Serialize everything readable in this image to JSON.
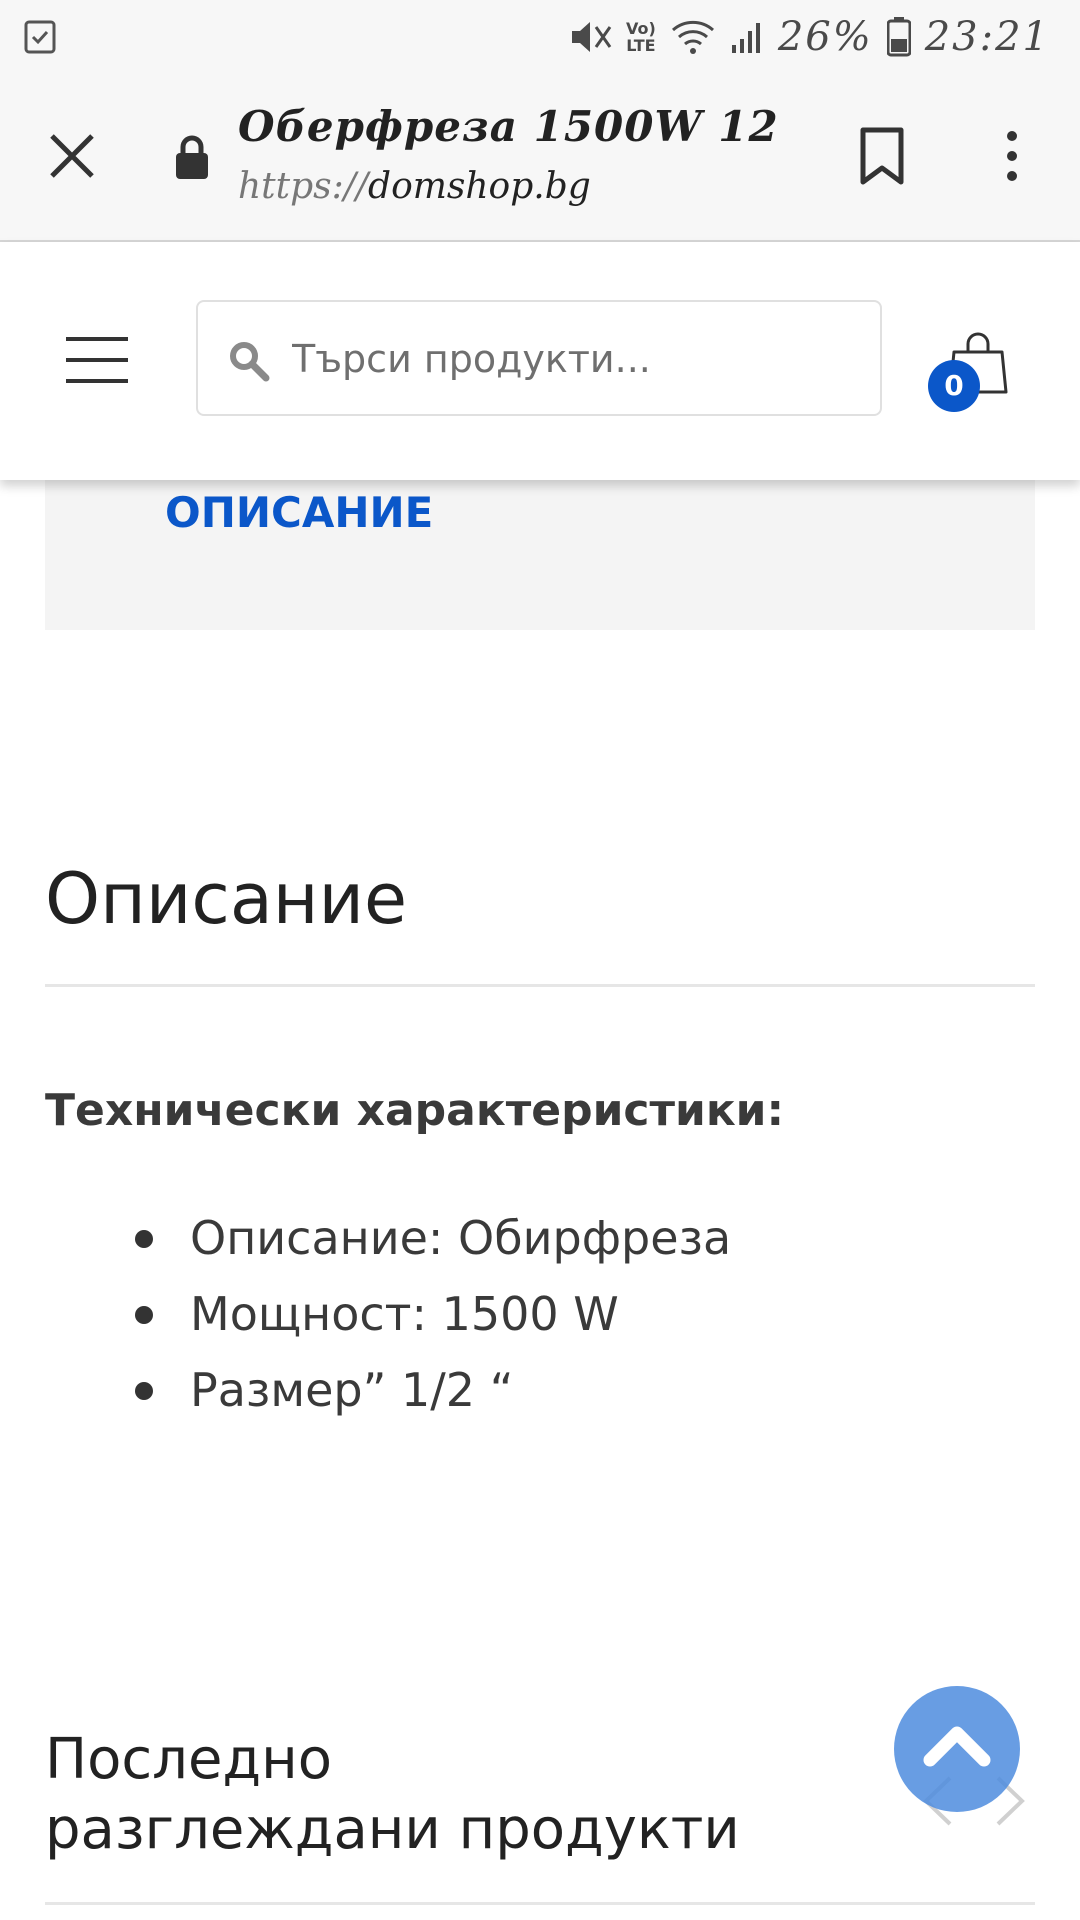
{
  "status_bar": {
    "battery": "26%",
    "time": "23:21",
    "network_top": "Vo)",
    "network_bottom": "LTE"
  },
  "browser": {
    "page_title": "Оберфреза 1500W 12\" ...",
    "url_protocol": "https://",
    "url_domain": "domshop.bg"
  },
  "header": {
    "search_placeholder": "Търси продукти...",
    "cart_count": "0"
  },
  "tab": {
    "label": "ОПИСАНИЕ"
  },
  "content": {
    "heading": "Описание",
    "specs_title": "Технически характеристики:",
    "specs": [
      "Описание: Обирфреза",
      "Мощност: 1500 W",
      "Размер” 1/2 “"
    ],
    "recent_heading": "Последно разглеждани продукти"
  },
  "colors": {
    "accent": "#0b57c9",
    "scroll_top_button": "#4d8cde"
  }
}
